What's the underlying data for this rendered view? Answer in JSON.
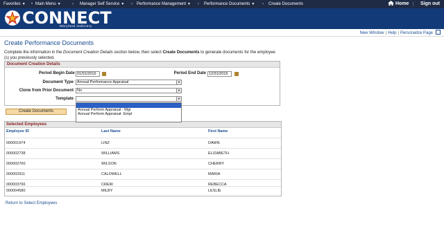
{
  "nav": {
    "items": [
      {
        "label": "Favorites"
      },
      {
        "label": "Main Menu"
      },
      {
        "label": "Manager Self Service"
      },
      {
        "label": "Performance Management"
      },
      {
        "label": "Performance Documents"
      },
      {
        "label": "Create Documents"
      }
    ],
    "home_label": "Home",
    "signout_label": "Sign out"
  },
  "banner": {
    "logo_text": "CONNECT",
    "logo_sub": "Maryland Judiciary"
  },
  "header_links": {
    "new_window": "New Window",
    "help": "Help",
    "personalize": "Personalize Page"
  },
  "page": {
    "title": "Create Performance Documents",
    "instructions_pre": "Complete the information in the ",
    "instructions_em": "Document Creation Details",
    "instructions_mid": " section below, then select ",
    "instructions_strong": "Create Documents",
    "instructions_post": " to generate documents for the employee (s) you previously selected."
  },
  "doc_details": {
    "section_title": "Document Creation Details",
    "period_begin_label": "Period Begin Date",
    "period_begin_value": "01/01/2016",
    "period_end_label": "Period End Date",
    "period_end_value": "12/31/2016",
    "doc_type_label": "Document Type",
    "doc_type_value": "Annual Performance Appraisal",
    "clone_label": "Clone from Prior Document",
    "clone_value": "No",
    "template_label": "Template",
    "template_value": "",
    "template_options": [
      "",
      "Annual Perform Appraisal - Mgr",
      "Annual Perform Appraisal- Empl"
    ],
    "create_button": "Create Documents"
  },
  "employees": {
    "section_title": "Selected Employees",
    "columns": [
      "Employee ID",
      "Last Name",
      "First Name"
    ],
    "rows": [
      [
        "000001974",
        "LINZ",
        "DAWN"
      ],
      [
        "000002738",
        "WILLIAMS",
        "ELIZABETH"
      ],
      [
        "000002760",
        "WILSON",
        "CHERRY"
      ],
      [
        "000002911",
        "CALDWELL",
        "MARIA"
      ],
      [
        "000003766",
        "CREW",
        "REBECCA"
      ],
      [
        "000004580",
        "MILBY",
        "LESLIE"
      ]
    ]
  },
  "return_link": "Return to Select Employees",
  "colors": {
    "nav_bg": "#1f2a44",
    "banner_bg": "#123a78",
    "link": "#1a4d8f",
    "section_title": "#8a1f1f",
    "button_bg": "#f5d9a3",
    "dropdown_highlight": "#2b5fc4"
  }
}
